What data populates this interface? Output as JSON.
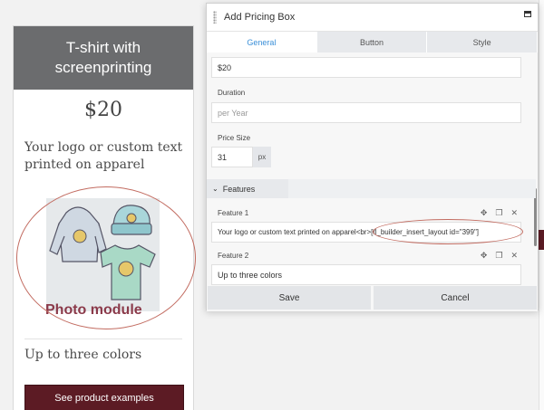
{
  "card": {
    "title": "T-shirt with screenprinting",
    "price": "$20",
    "description": "Your logo or custom text printed on apparel",
    "photo_caption": "Photo module",
    "feature": "Up to three colors",
    "cta_label": "See product examples"
  },
  "panel": {
    "title": "Add Pricing Box",
    "tabs": [
      {
        "label": "General",
        "active": true
      },
      {
        "label": "Button",
        "active": false
      },
      {
        "label": "Style",
        "active": false
      }
    ],
    "price_value": "$20",
    "duration_label": "Duration",
    "duration_placeholder": "per Year",
    "price_size_label": "Price Size",
    "price_size_value": "31",
    "price_size_unit": "px",
    "features_label": "Features",
    "features": [
      {
        "label": "Feature 1",
        "value": "Your logo or custom text printed on apparel<br>[fl_builder_insert_layout id=\"399\"]"
      },
      {
        "label": "Feature 2",
        "value": "Up to three colors"
      }
    ],
    "save_label": "Save",
    "cancel_label": "Cancel"
  },
  "colors": {
    "header_gray": "#6b6c6e",
    "cta_maroon": "#5c1b24",
    "accent_blue": "#3a8fd8",
    "annotation_red": "#c26b60",
    "photo_caption": "#8b3a4a"
  },
  "icons": [
    "move-icon",
    "copy-icon",
    "close-icon",
    "window-icon",
    "drag-grip-icon",
    "collapse-caret-icon"
  ]
}
